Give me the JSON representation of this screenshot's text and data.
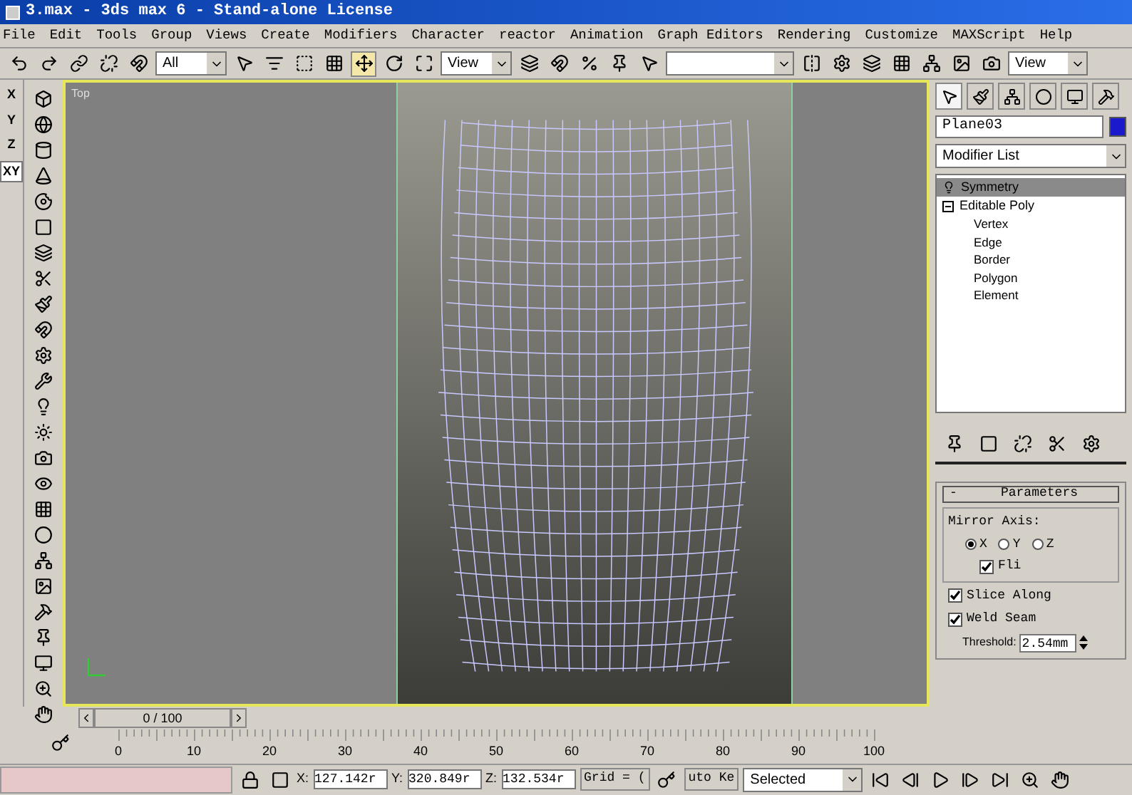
{
  "window": {
    "title": "3.max - 3ds max 6 - Stand-alone License"
  },
  "menu": [
    "File",
    "Edit",
    "Tools",
    "Group",
    "Views",
    "Create",
    "Modifiers",
    "Character",
    "reactor",
    "Animation",
    "Graph Editors",
    "Rendering",
    "Customize",
    "MAXScript",
    "Help"
  ],
  "toolbar": {
    "selection_filter": "All",
    "reference_coord": "View",
    "view_menu": "View"
  },
  "axes": [
    {
      "label": "X",
      "selected": false
    },
    {
      "label": "Y",
      "selected": false
    },
    {
      "label": "Z",
      "selected": false
    },
    {
      "label": "XY",
      "selected": true
    }
  ],
  "viewport": {
    "label": "Top",
    "active": true
  },
  "command_panel": {
    "tabs": [
      {
        "selected": true
      },
      {
        "selected": false
      },
      {
        "selected": false
      },
      {
        "selected": false
      },
      {
        "selected": false
      },
      {
        "selected": false
      }
    ],
    "object_name": "Plane03",
    "modifier_list": "Modifier List",
    "stack": [
      {
        "label": "Symmetry",
        "selected": true
      },
      {
        "label": "Editable Poly",
        "selected": false,
        "expanded": true,
        "children": [
          {
            "label": "Vertex"
          },
          {
            "label": "Edge"
          },
          {
            "label": "Border"
          },
          {
            "label": "Polygon"
          },
          {
            "label": "Element"
          }
        ]
      }
    ],
    "parameters": {
      "collapse": "-",
      "title": "Parameters",
      "group": "Mirror Axis:",
      "axes": [
        {
          "label": "X",
          "selected": true
        },
        {
          "label": "Y",
          "selected": false
        },
        {
          "label": "Z",
          "selected": false
        }
      ],
      "flip": {
        "label": "Fli",
        "checked": true
      },
      "checks": [
        {
          "label": "Slice Along",
          "checked": true
        },
        {
          "label": "Weld Seam",
          "checked": true
        }
      ],
      "threshold_label": "Threshold:",
      "threshold": "2.54mm"
    }
  },
  "timeline": {
    "position": "0 / 100",
    "ruler": [
      "0",
      "10",
      "20",
      "30",
      "40",
      "50",
      "60",
      "70",
      "80",
      "90",
      "100"
    ]
  },
  "status_bar": {
    "x_label": "X:",
    "x": "127.142r",
    "y_label": "Y:",
    "y": "320.849r",
    "z_label": "Z:",
    "z": "132.534r",
    "grid": "Grid = (",
    "auto_key": "uto Ke",
    "key_mode": "Selected"
  }
}
